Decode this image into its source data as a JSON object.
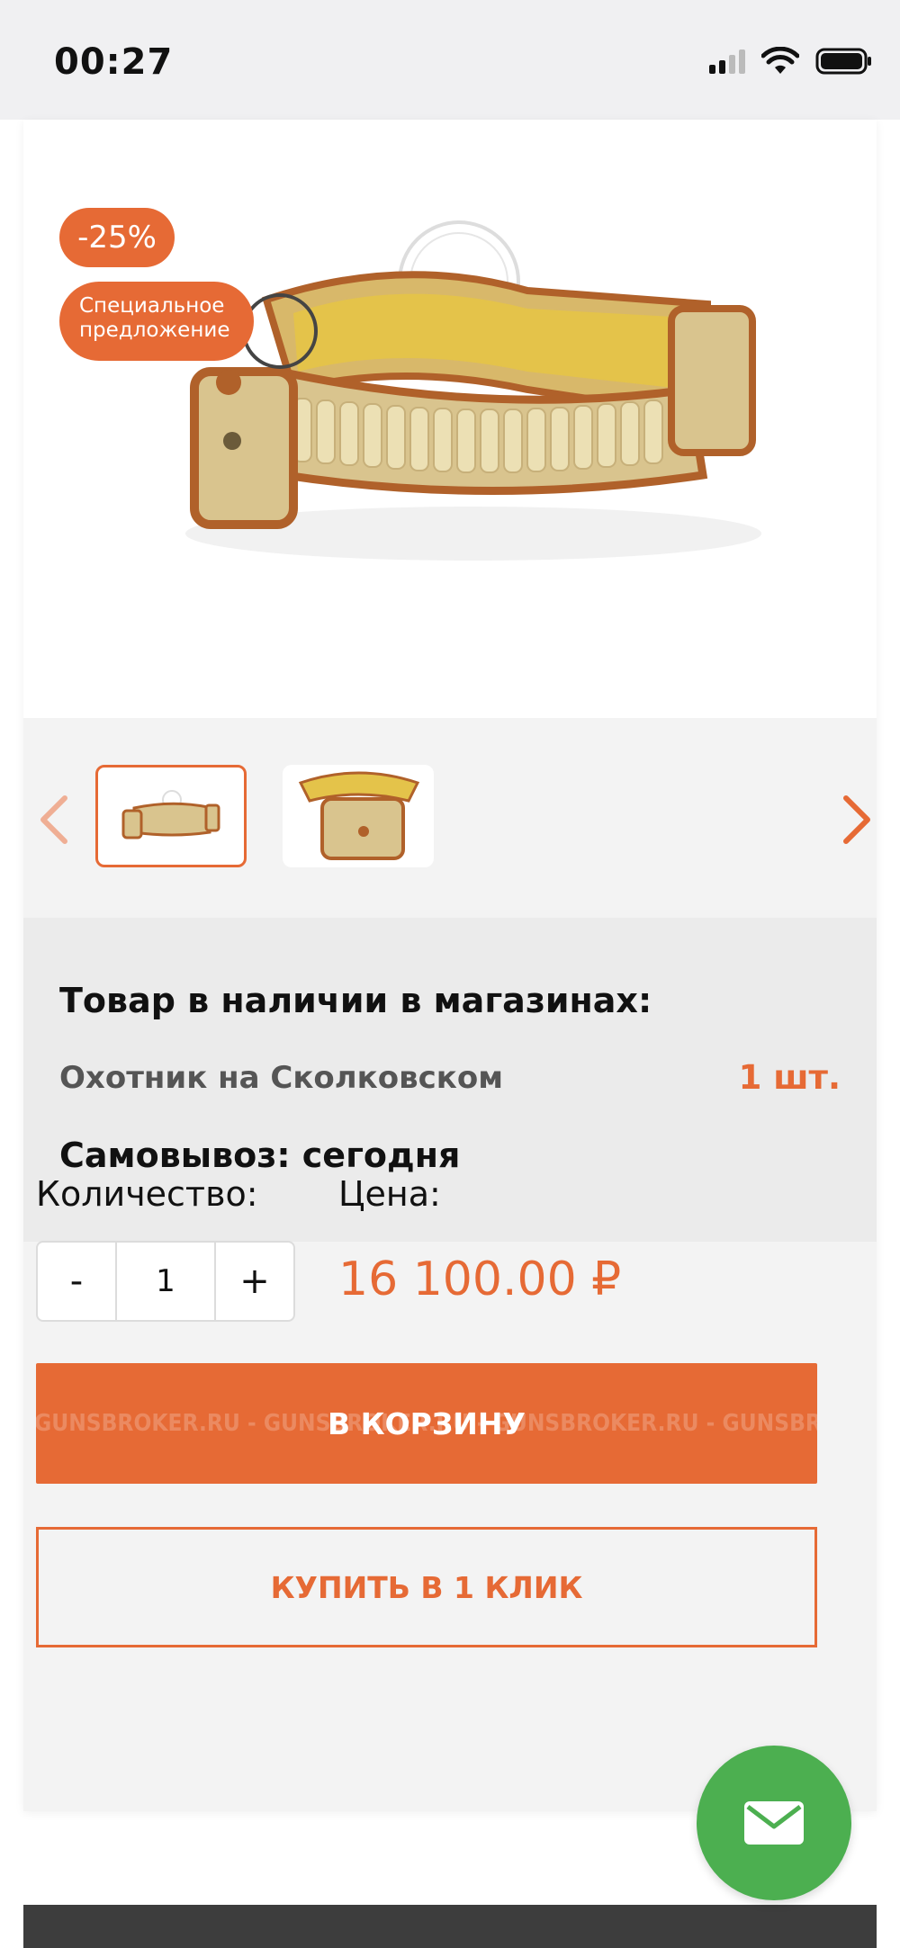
{
  "status_bar": {
    "time": "00:27"
  },
  "product": {
    "badges": {
      "discount": "-25%",
      "special": "Специальное предложение"
    },
    "stock": {
      "title": "Товар в наличии в магазинах:",
      "store_name": "Охотник на Сколковском",
      "store_qty": "1 шт.",
      "pickup": "Самовывоз: сегодня"
    },
    "quantity_label": "Количество:",
    "quantity_value": "1",
    "stepper_minus": "-",
    "stepper_plus": "+",
    "price_label": "Цена:",
    "price": "16 100.00 ₽"
  },
  "buttons": {
    "cart": "В КОРЗИНУ",
    "cart_watermark": "GUNSBROKER.RU - GUNSBROKER.RU - GUNSBROKER.RU - GUNSBROKER.RU - GUNSBROKER.RU",
    "one_click": "КУПИТЬ В 1 КЛИК"
  },
  "colors": {
    "accent": "#e66a35",
    "fab": "#4caf50",
    "stock_bg": "#ebebeb"
  },
  "icons": [
    "signal-icon",
    "wifi-icon",
    "battery-icon",
    "chevron-left-icon",
    "chevron-right-icon",
    "mail-icon"
  ]
}
